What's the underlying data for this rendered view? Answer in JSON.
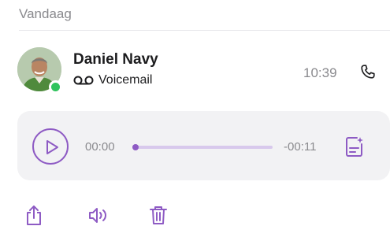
{
  "section": {
    "title": "Vandaag"
  },
  "contact": {
    "name": "Daniel Navy",
    "call_type": "Voicemail",
    "time": "10:39",
    "status_color": "#2fc35c",
    "avatar_icon": "person-photo",
    "call_type_icon": "voicemail-icon",
    "call_action_icon": "phone-icon"
  },
  "player": {
    "elapsed": "00:00",
    "remaining": "-00:11",
    "progress_fraction": 0,
    "play_icon": "play-icon",
    "transcript_icon": "transcript-icon"
  },
  "actions": [
    {
      "name": "share",
      "icon": "share-icon"
    },
    {
      "name": "speaker",
      "icon": "speaker-icon"
    },
    {
      "name": "delete",
      "icon": "trash-icon"
    }
  ],
  "colors": {
    "accent": "#8e5bc4",
    "accent_light": "#d8c9ec",
    "secondary_text": "#8a8a8e",
    "panel_bg": "#f2f2f4"
  }
}
